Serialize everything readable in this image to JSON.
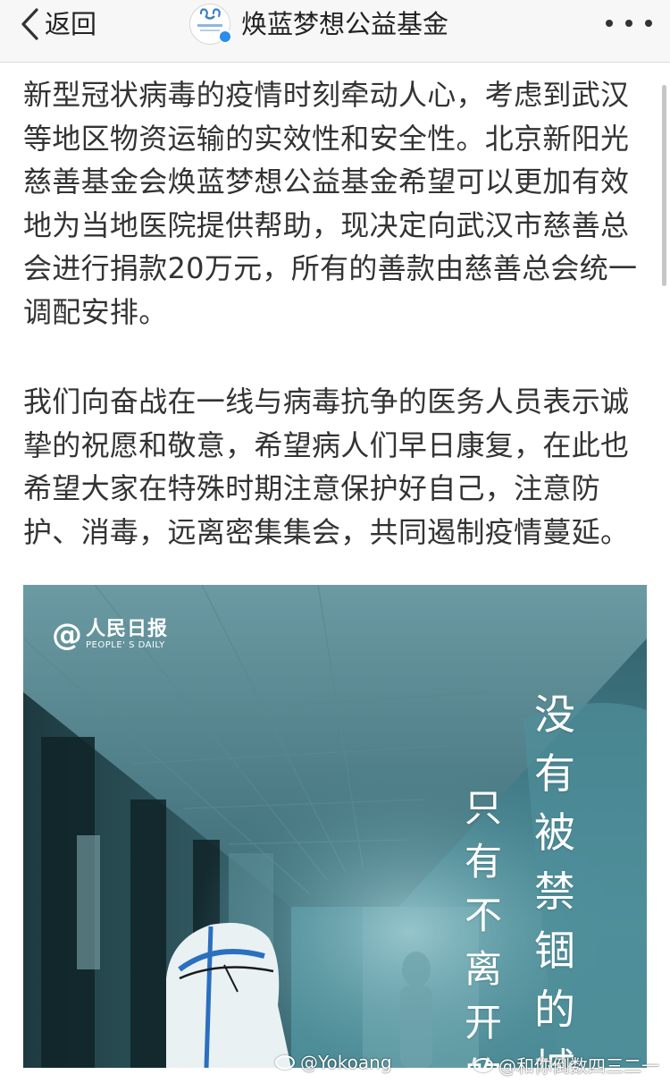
{
  "header": {
    "back_label": "返回",
    "title": "焕蓝梦想公益基金",
    "accent": "#2a8df0"
  },
  "article": {
    "paragraphs": [
      "新型冠状病毒的疫情时刻牵动人心，考虑到武汉等地区物资运输的实效性和安全性。北京新阳光慈善基金会焕蓝梦想公益基金希望可以更加有效地为当地医院提供帮助，现决定向武汉市慈善总会进行捐款20万元，所有的善款由慈善总会统一调配安排。",
      "我们向奋战在一线与病毒抗争的医务人员表示诚挚的祝愿和敬意，希望病人们早日康复，在此也希望大家在特殊时期注意保护好自己，注意防护、消毒，远离密集集会，共同遏制疫情蔓延。"
    ]
  },
  "poster": {
    "logo_at": "@",
    "logo_name": "人民日报",
    "logo_en": "PEOPLE' S DAILY",
    "col1": [
      "没",
      "有",
      "被",
      "禁",
      "锢",
      "的",
      "城"
    ],
    "col2": [
      "只",
      "有",
      "不",
      "离",
      "开",
      "的"
    ]
  },
  "watermarks": [
    "@Yokoang",
    "@和你倒数四三二一"
  ]
}
